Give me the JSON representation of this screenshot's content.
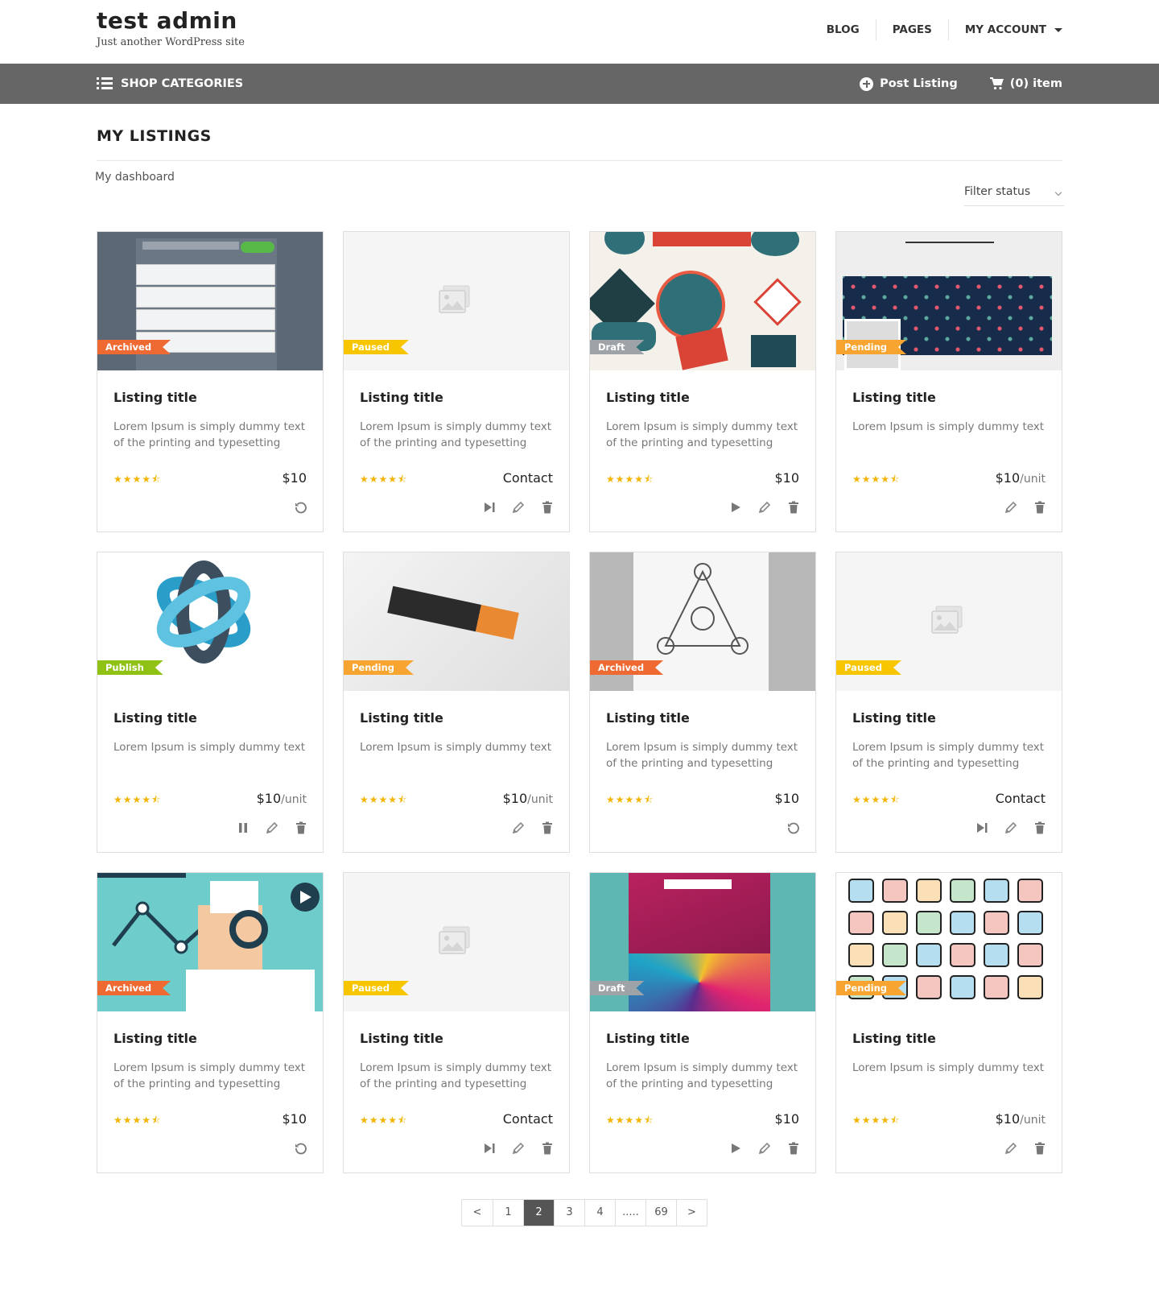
{
  "site": {
    "title": "test admin",
    "tagline": "Just another WordPress site"
  },
  "topnav": {
    "blog": "BLOG",
    "pages": "PAGES",
    "account": "MY ACCOUNT"
  },
  "bar": {
    "categories": "SHOP CATEGORIES",
    "post_listing": "Post Listing",
    "cart": "(0) item"
  },
  "page": {
    "title": "MY LISTINGS",
    "breadcrumb": "My dashboard",
    "filter": "Filter status"
  },
  "colors": {
    "archived": "#ee6a32",
    "paused": "#f7c600",
    "draft": "#9ea3a8",
    "pending": "#f7a530",
    "publish": "#8fc215",
    "stars": "#f3b400"
  },
  "cards": [
    {
      "status": "Archived",
      "title": "Listing title",
      "desc": "Lorem Ipsum is simply dummy text of the printing and typesetting",
      "price": "$10",
      "unit": "",
      "rating": 4.5,
      "actions": [
        "restore-icon"
      ],
      "image": "form-mockup"
    },
    {
      "status": "Paused",
      "title": "Listing title",
      "desc": "Lorem Ipsum is simply dummy text of the printing and typesetting",
      "price": "Contact",
      "unit": "",
      "rating": 4.5,
      "actions": [
        "resume-icon",
        "edit-icon",
        "delete-icon"
      ],
      "image": "placeholder"
    },
    {
      "status": "Draft",
      "title": "Listing title",
      "desc": "Lorem Ipsum is simply dummy text of the printing and typesetting",
      "price": "$10",
      "unit": "",
      "rating": 4.5,
      "actions": [
        "play-icon",
        "edit-icon",
        "delete-icon"
      ],
      "image": "badges"
    },
    {
      "status": "Pending",
      "title": "Listing title",
      "desc": "Lorem Ipsum is simply dummy text",
      "price": "$10",
      "unit": "/unit",
      "rating": 4.5,
      "actions": [
        "edit-icon",
        "delete-icon"
      ],
      "image": "flowers"
    },
    {
      "status": "Publish",
      "title": "Listing title",
      "desc": "Lorem Ipsum is simply dummy text",
      "price": "$10",
      "unit": "/unit",
      "rating": 4.5,
      "actions": [
        "pause-icon",
        "edit-icon",
        "delete-icon"
      ],
      "image": "aiming"
    },
    {
      "status": "Pending",
      "title": "Listing title",
      "desc": "Lorem Ipsum is simply dummy text",
      "price": "$10",
      "unit": "/unit",
      "rating": 4.5,
      "actions": [
        "edit-icon",
        "delete-icon"
      ],
      "image": "fox"
    },
    {
      "status": "Archived",
      "title": "Listing title",
      "desc": "Lorem Ipsum is simply dummy text of the printing and typesetting",
      "price": "$10",
      "unit": "",
      "rating": 4.5,
      "actions": [
        "restore-icon"
      ],
      "image": "geometric"
    },
    {
      "status": "Paused",
      "title": "Listing title",
      "desc": "Lorem Ipsum is simply dummy text of the printing and typesetting",
      "price": "Contact",
      "unit": "",
      "rating": 4.5,
      "actions": [
        "resume-icon",
        "edit-icon",
        "delete-icon"
      ],
      "image": "placeholder"
    },
    {
      "status": "Archived",
      "title": "Listing title",
      "desc": "Lorem Ipsum is simply dummy text of the printing and typesetting",
      "price": "$10",
      "unit": "",
      "rating": 4.5,
      "actions": [
        "restore-icon"
      ],
      "image": "analyst"
    },
    {
      "status": "Paused",
      "title": "Listing title",
      "desc": "Lorem Ipsum is simply dummy text of the printing and typesetting",
      "price": "Contact",
      "unit": "",
      "rating": 4.5,
      "actions": [
        "resume-icon",
        "edit-icon",
        "delete-icon"
      ],
      "image": "placeholder"
    },
    {
      "status": "Draft",
      "title": "Listing title",
      "desc": "Lorem Ipsum is simply dummy text of the printing and typesetting",
      "price": "$10",
      "unit": "",
      "rating": 4.5,
      "actions": [
        "play-icon",
        "edit-icon",
        "delete-icon"
      ],
      "image": "poster"
    },
    {
      "status": "Pending",
      "title": "Listing title",
      "desc": "Lorem Ipsum is simply dummy text",
      "price": "$10",
      "unit": "/unit",
      "rating": 4.5,
      "actions": [
        "edit-icon",
        "delete-icon"
      ],
      "image": "icons"
    }
  ],
  "pagination": {
    "prev": "<",
    "pages": [
      "1",
      "2",
      "3",
      "4",
      ".....",
      "69"
    ],
    "current": "2",
    "next": ">"
  }
}
